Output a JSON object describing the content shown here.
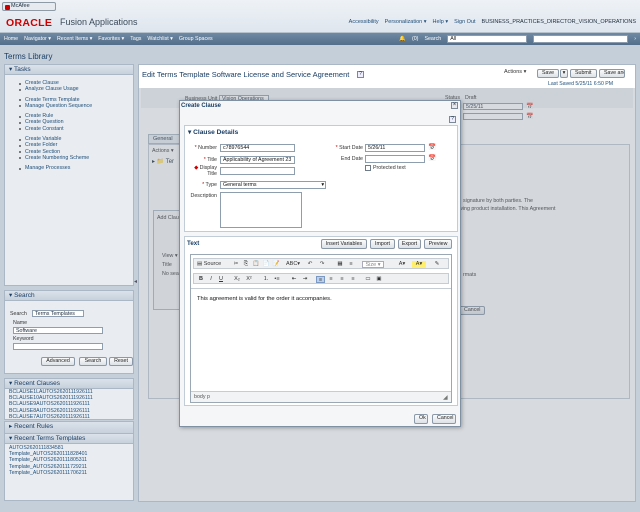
{
  "topbar": {
    "mcafee": "McAfee",
    "logo": "ORACLE",
    "app_title": "Fusion Applications",
    "links": [
      "Accessibility",
      "Personalization ▾",
      "Help ▾",
      "Sign Out",
      "BUSINESS_PRACTICES_DIRECTOR_VISION_OPERATIONS"
    ]
  },
  "navbar": {
    "items": [
      "Home",
      "Navigator ▾",
      "Recent Items ▾",
      "Favorites ▾",
      "Tags",
      "Watchlist ▾",
      "Group Spaces"
    ],
    "count": "(0)",
    "search_label": "Search",
    "search_scope": "All"
  },
  "left": {
    "page_title": "Terms Library",
    "tasks_title": "Tasks",
    "task_groups": [
      [
        "Create Clause",
        "Analyze Clause Usage"
      ],
      [
        "Create Terms Template",
        "Manage Question Sequence"
      ],
      [
        "Create Rule",
        "Create Question",
        "Create Constant"
      ],
      [
        "Create Variable",
        "Create Folder",
        "Create Section",
        "Create Numbering Scheme"
      ],
      [
        "Manage Processes"
      ]
    ],
    "search_title": "Search",
    "search_label": "Search",
    "search_value": "Terms Templates",
    "name_label": "Name",
    "name_value": "Software",
    "keyword_label": "Keyword",
    "advanced": "Advanced",
    "search_btn": "Search",
    "reset_btn": "Reset",
    "recent_clauses_title": "Recent Clauses",
    "recent_clauses": [
      "BCLAUSE1LAUTOS2620111926111",
      "BCLAUSE10AUTOS2620111926111",
      "BCLAUSE9AUTOS2620111926111",
      "BCLAUSE8AUTOS2620111926111",
      "BCLAUSE7AUTOS2620111926111"
    ],
    "recent_rules_title": "Recent Rules",
    "recent_templates_title": "Recent Terms Templates",
    "recent_templates": [
      "AUTOS2620111834581",
      "Template_AUTOS2620111828401",
      "Template_AUTOS2620111805311",
      "Template_AUTOS2620111729211",
      "Template_AUTOS2620111706211"
    ]
  },
  "main": {
    "title": "Edit Terms Template Software License and Service Agreement",
    "actions": "Actions ▾",
    "save": "Save",
    "submit": "Submit",
    "save_close": "Save and Close",
    "last_saved": "Last Saved 5/25/11 6:50 PM",
    "status_label": "Status",
    "status_value": "Draft",
    "business_unit_label": "Business Unit",
    "business_unit_value": "Vision Operations",
    "date_value": "5/25/11",
    "general_tab": "General",
    "bg_actions": "Actions ▾",
    "bg_text_1": "signature by both parties. The",
    "bg_text_2": "wing product installation. This Agreement",
    "add_clause": "Add Clau",
    "view": "View ▾",
    "no_search": "No searc",
    "title_col": "Title",
    "formats": "rmats",
    "cancel_bg": "Cancel"
  },
  "modal": {
    "title": "Create Clause",
    "section_title": "Clause Details",
    "number_label": "Number",
    "number_value": "c78976544",
    "title_label": "Title",
    "title_value": "Applicability of Agreement 23",
    "display_title_label": "Display Title",
    "type_label": "Type",
    "type_value": "General terms",
    "description_label": "Description",
    "start_date_label": "Start Date",
    "start_date_value": "5/26/11",
    "end_date_label": "End Date",
    "protected_text": "Protected text",
    "text_title": "Text",
    "insert_variables": "Insert Variables",
    "import": "Import",
    "export": "Export",
    "preview": "Preview",
    "toolbar_source": "Source",
    "toolbar_size": "Size",
    "editor_text": "This agreement is valid for the order it accompanies.",
    "status_path": "body p",
    "ok": "Ok",
    "cancel": "Cancel"
  }
}
